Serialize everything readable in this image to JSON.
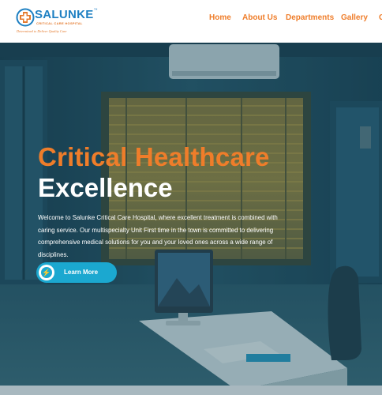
{
  "brand": {
    "name": "SALUNKE",
    "trademark": "™",
    "subtitle": "CRITICAL CARE HOSPITAL",
    "tagline": "Determined to Deliver Quality Care"
  },
  "nav": {
    "items": [
      {
        "label": "Home"
      },
      {
        "label": "About Us"
      },
      {
        "label": "Departments"
      },
      {
        "label": "Gallery"
      },
      {
        "label": "C"
      }
    ]
  },
  "hero": {
    "title_line1": "Critical Healthcare",
    "title_line2": "Excellence",
    "description": "Welcome to Salunke Critical Care Hospital, where excellent treatment is combined with caring service. Our multispecialty Unit First time in the town is committed to delivering comprehensive medical solutions for you and your loved ones across a wide range of disciplines.",
    "cta_label": "Learn More",
    "cta_icon": "lightning-icon"
  },
  "colors": {
    "accent": "#ef7d2a",
    "brand_blue": "#1d7fc2",
    "button": "#1ba8d0",
    "overlay": "#153d50"
  }
}
